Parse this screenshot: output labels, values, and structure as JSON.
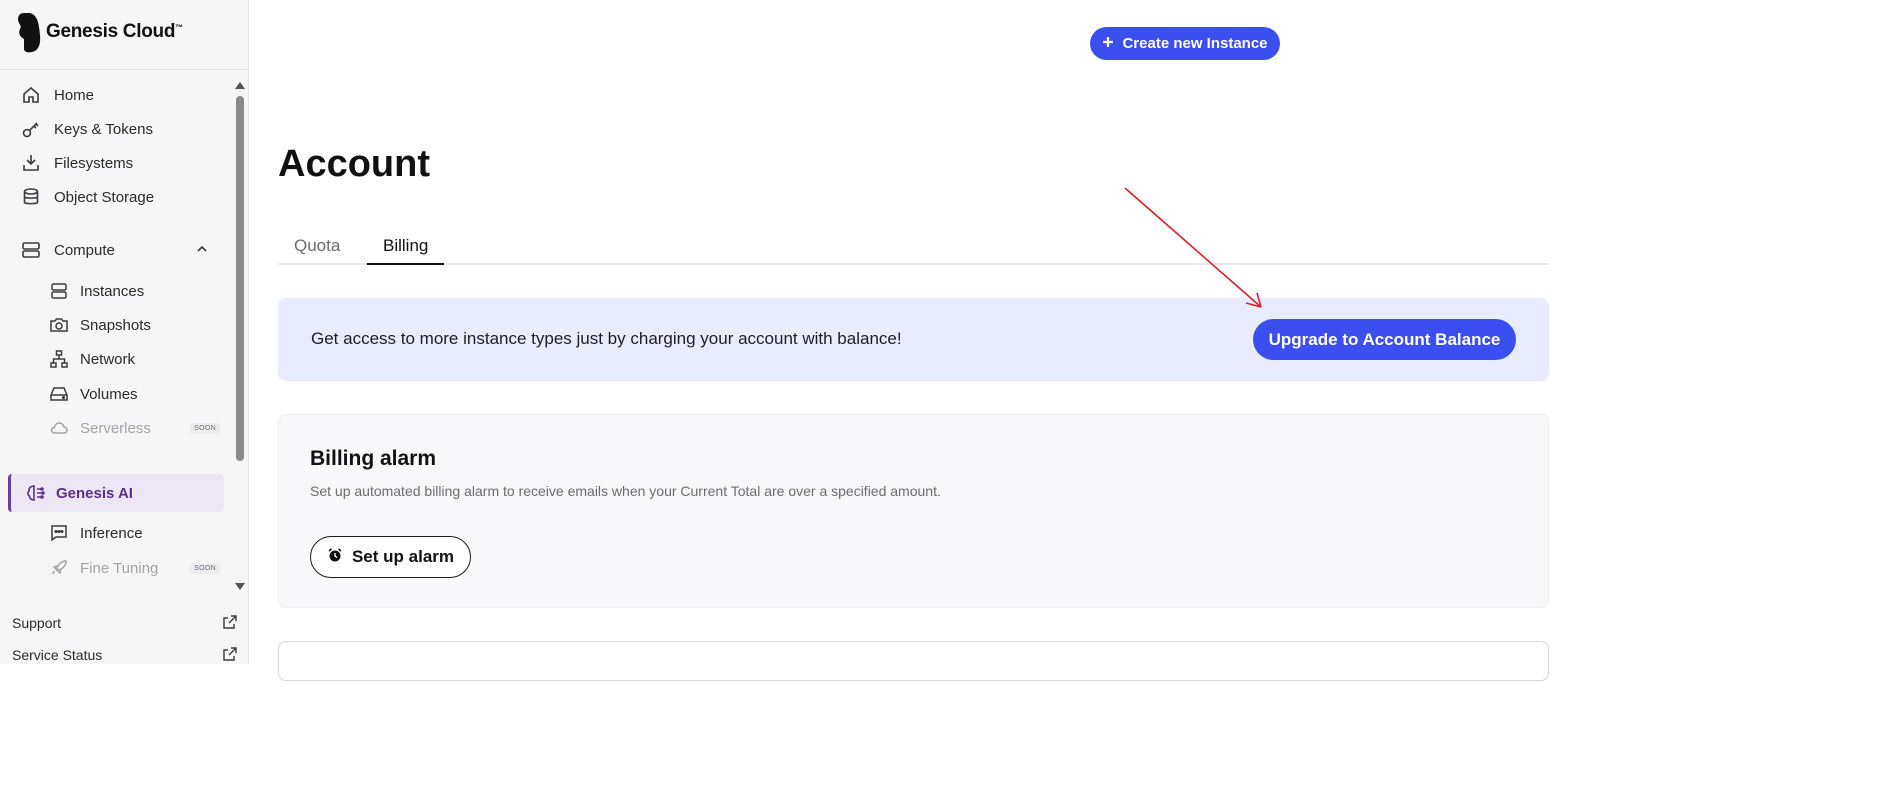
{
  "brand": {
    "name": "Genesis Cloud",
    "trademark": "™"
  },
  "sidebar": {
    "items": [
      {
        "label": "Home",
        "icon": "home-icon"
      },
      {
        "label": "Keys & Tokens",
        "icon": "key-icon"
      },
      {
        "label": "Filesystems",
        "icon": "download-icon"
      },
      {
        "label": "Object Storage",
        "icon": "database-icon"
      }
    ],
    "compute": {
      "label": "Compute",
      "expanded": true,
      "children": [
        {
          "label": "Instances",
          "icon": "server-icon"
        },
        {
          "label": "Snapshots",
          "icon": "camera-icon"
        },
        {
          "label": "Network",
          "icon": "network-icon"
        },
        {
          "label": "Volumes",
          "icon": "drive-icon"
        },
        {
          "label": "Serverless",
          "icon": "cloud-icon",
          "badge": "SOON",
          "disabled": true
        }
      ]
    },
    "genesis_ai": {
      "label": "Genesis AI",
      "active": true,
      "children": [
        {
          "label": "Inference",
          "icon": "chat-icon"
        },
        {
          "label": "Fine Tuning",
          "icon": "rocket-icon",
          "badge": "SOON",
          "disabled": true
        }
      ]
    },
    "bottom_links": [
      {
        "label": "Support",
        "icon": "external-link-icon"
      },
      {
        "label": "Service Status",
        "icon": "external-link-icon"
      }
    ]
  },
  "header": {
    "create_button": "Create new Instance"
  },
  "page": {
    "title": "Account",
    "tabs": [
      {
        "label": "Quota",
        "active": false
      },
      {
        "label": "Billing",
        "active": true
      }
    ]
  },
  "banner": {
    "text": "Get access to more instance types just by charging your account with balance!",
    "button": "Upgrade to Account Balance"
  },
  "billing_alarm": {
    "title": "Billing alarm",
    "description": "Set up automated billing alarm to receive emails when your Current Total are over a specified amount.",
    "button": "Set up alarm"
  },
  "colors": {
    "accent": "#3b4ff0",
    "banner_bg": "#e9ecfc",
    "ai_active": "#5b2f8e",
    "annotation_arrow": "#e0202a"
  }
}
